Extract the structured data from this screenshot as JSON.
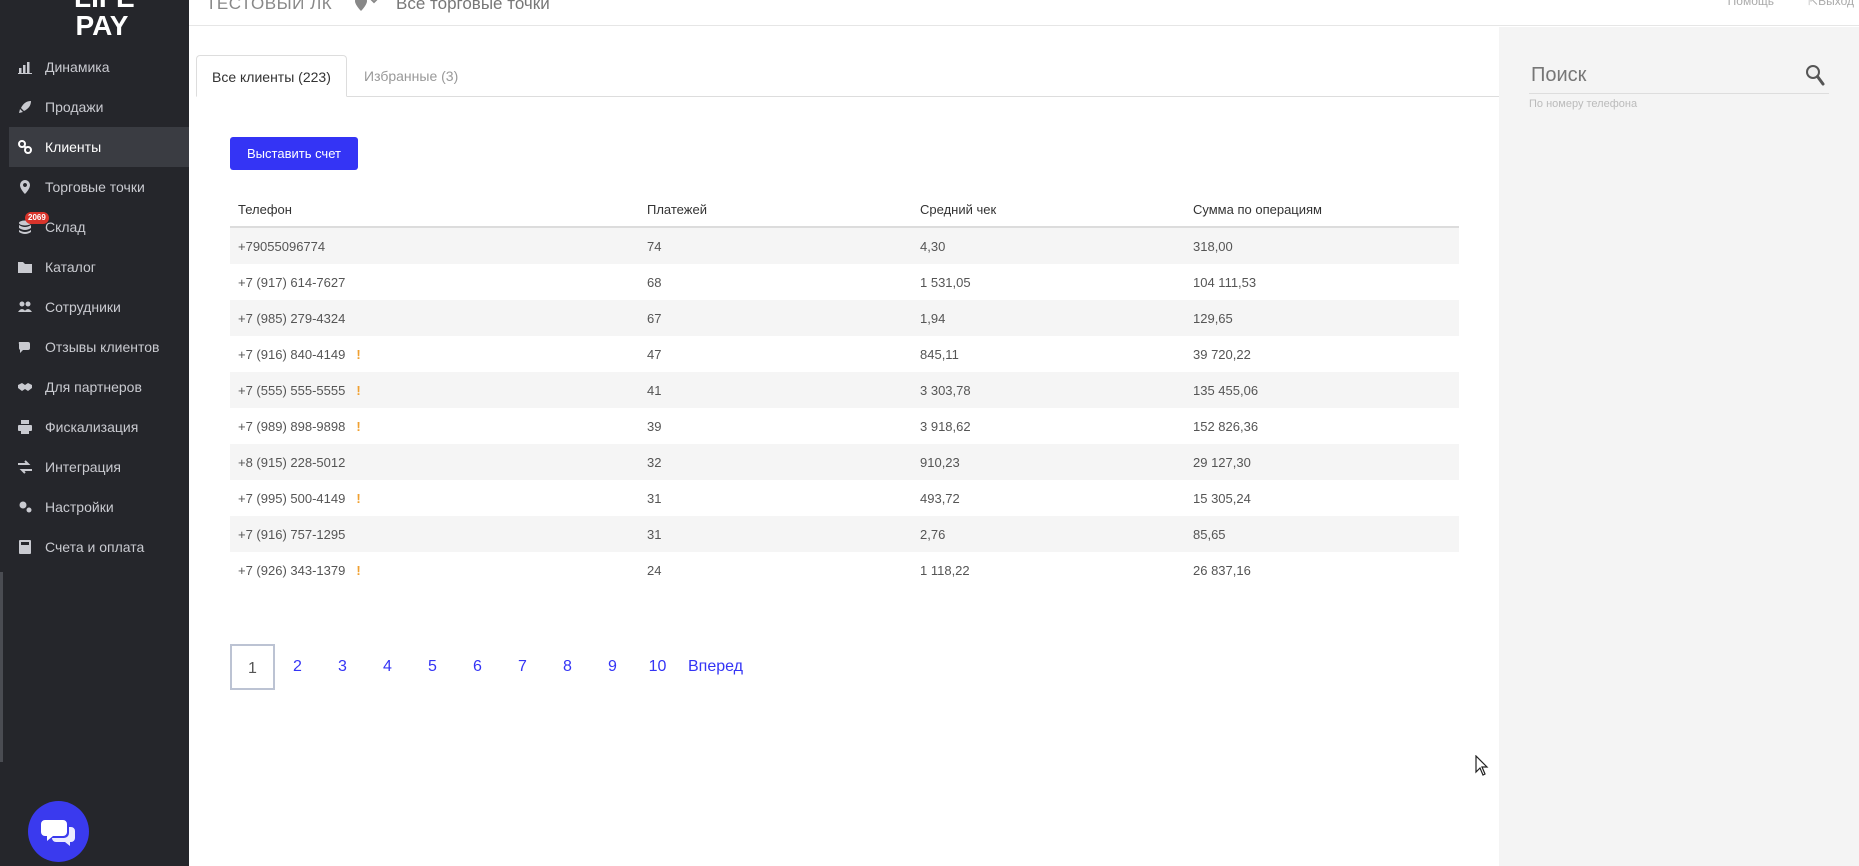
{
  "logo": {
    "line1": "LIFE",
    "line2": "PAY"
  },
  "sidebar": {
    "items": [
      {
        "label": "Динамика",
        "icon": "bar-chart-icon"
      },
      {
        "label": "Продажи",
        "icon": "rocket-icon"
      },
      {
        "label": "Клиенты",
        "icon": "link-icon"
      },
      {
        "label": "Торговые точки",
        "icon": "map-pin-icon"
      },
      {
        "label": "Склад",
        "icon": "database-icon",
        "badge": "2069"
      },
      {
        "label": "Каталог",
        "icon": "folder-icon"
      },
      {
        "label": "Сотрудники",
        "icon": "users-icon"
      },
      {
        "label": "Отзывы клиентов",
        "icon": "comments-icon"
      },
      {
        "label": "Для партнеров",
        "icon": "handshake-icon"
      },
      {
        "label": "Фискализация",
        "icon": "printer-icon"
      },
      {
        "label": "Интеграция",
        "icon": "exchange-icon"
      },
      {
        "label": "Настройки",
        "icon": "cogs-icon"
      },
      {
        "label": "Счета и оплата",
        "icon": "calculator-icon"
      }
    ],
    "active_index": 2
  },
  "topbar": {
    "account": "ТЕСТОВЫЙ ЛК",
    "shops": "Все торговые точки",
    "help": "Помощь",
    "exit": "Выход"
  },
  "tabs": {
    "all": "Все клиенты (223)",
    "favorites": "Избранные (3)"
  },
  "invoice_button": "Выставить счет",
  "table": {
    "headers": [
      "Телефон",
      "Платежей",
      "Средний чек",
      "Сумма по операциям"
    ],
    "rows": [
      {
        "phone": "+79055096774",
        "payments": "74",
        "avg": "4,30",
        "sum": "318,00",
        "warn": false
      },
      {
        "phone": "+7 (917) 614-7627",
        "payments": "68",
        "avg": "1 531,05",
        "sum": "104 111,53",
        "warn": false
      },
      {
        "phone": "+7 (985) 279-4324",
        "payments": "67",
        "avg": "1,94",
        "sum": "129,65",
        "warn": false
      },
      {
        "phone": "+7 (916) 840-4149",
        "payments": "47",
        "avg": "845,11",
        "sum": "39 720,22",
        "warn": true
      },
      {
        "phone": "+7 (555) 555-5555",
        "payments": "41",
        "avg": "3 303,78",
        "sum": "135 455,06",
        "warn": true
      },
      {
        "phone": "+7 (989) 898-9898",
        "payments": "39",
        "avg": "3 918,62",
        "sum": "152 826,36",
        "warn": true
      },
      {
        "phone": "+8 (915) 228-5012",
        "payments": "32",
        "avg": "910,23",
        "sum": "29 127,30",
        "warn": false
      },
      {
        "phone": "+7 (995) 500-4149",
        "payments": "31",
        "avg": "493,72",
        "sum": "15 305,24",
        "warn": true
      },
      {
        "phone": "+7 (916) 757-1295",
        "payments": "31",
        "avg": "2,76",
        "sum": "85,65",
        "warn": false
      },
      {
        "phone": "+7 (926) 343-1379",
        "payments": "24",
        "avg": "1 118,22",
        "sum": "26 837,16",
        "warn": true
      }
    ],
    "warn_mark": "!"
  },
  "pagination": {
    "pages": [
      "1",
      "2",
      "3",
      "4",
      "5",
      "6",
      "7",
      "8",
      "9",
      "10"
    ],
    "current": "1",
    "next": "Вперед"
  },
  "search": {
    "placeholder": "Поиск",
    "hint": "По номеру телефона"
  },
  "colors": {
    "accent": "#3434f5",
    "sidebar_bg": "#25262b",
    "badge": "#d9342b",
    "warn": "#f0a030"
  }
}
